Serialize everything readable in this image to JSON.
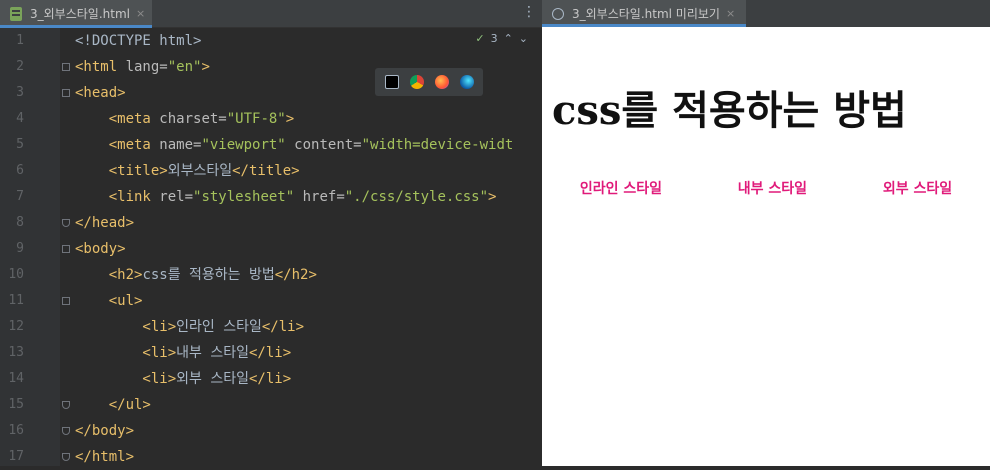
{
  "editor": {
    "tab": {
      "label": "3_외부스타일.html",
      "close": "×"
    },
    "menu_glyph": "⋮",
    "inspection": {
      "count": "3",
      "check": "✓"
    },
    "browser_icons": [
      "pycharm-icon",
      "chrome-icon",
      "firefox-icon",
      "edge-icon"
    ],
    "lines": [
      {
        "n": "1",
        "parts": [
          {
            "t": "&lt;!DOCTYPE html&gt;",
            "c": "text"
          }
        ]
      },
      {
        "n": "2",
        "parts": [
          {
            "t": "<html ",
            "c": "tag"
          },
          {
            "t": "lang=",
            "c": "attr"
          },
          {
            "t": "\"en\"",
            "c": "val"
          },
          {
            "t": ">",
            "c": "tag"
          }
        ]
      },
      {
        "n": "3",
        "parts": [
          {
            "t": "<head>",
            "c": "tag"
          }
        ]
      },
      {
        "n": "4",
        "parts": [
          {
            "t": "    <meta ",
            "c": "tag"
          },
          {
            "t": "charset=",
            "c": "attr"
          },
          {
            "t": "\"UTF-8\"",
            "c": "val"
          },
          {
            "t": ">",
            "c": "tag"
          }
        ]
      },
      {
        "n": "5",
        "parts": [
          {
            "t": "    <meta ",
            "c": "tag"
          },
          {
            "t": "name=",
            "c": "attr"
          },
          {
            "t": "\"viewport\"",
            "c": "val"
          },
          {
            "t": " content=",
            "c": "attr"
          },
          {
            "t": "\"width=device-widt",
            "c": "val"
          }
        ]
      },
      {
        "n": "6",
        "parts": [
          {
            "t": "    <title>",
            "c": "tag"
          },
          {
            "t": "외부스타일",
            "c": "text"
          },
          {
            "t": "</title>",
            "c": "tag"
          }
        ]
      },
      {
        "n": "7",
        "parts": [
          {
            "t": "    <link ",
            "c": "tag"
          },
          {
            "t": "rel=",
            "c": "attr"
          },
          {
            "t": "\"stylesheet\"",
            "c": "val"
          },
          {
            "t": " href=",
            "c": "attr"
          },
          {
            "t": "\"./css/style.css\"",
            "c": "val"
          },
          {
            "t": ">",
            "c": "tag"
          }
        ]
      },
      {
        "n": "8",
        "parts": [
          {
            "t": "</head>",
            "c": "tag"
          }
        ]
      },
      {
        "n": "9",
        "parts": [
          {
            "t": "<body>",
            "c": "tag"
          }
        ]
      },
      {
        "n": "10",
        "parts": [
          {
            "t": "    <h2>",
            "c": "tag"
          },
          {
            "t": "css를 적용하는 방법",
            "c": "text"
          },
          {
            "t": "</h2>",
            "c": "tag"
          }
        ]
      },
      {
        "n": "11",
        "parts": [
          {
            "t": "    <ul>",
            "c": "tag"
          }
        ]
      },
      {
        "n": "12",
        "parts": [
          {
            "t": "        <li>",
            "c": "tag"
          },
          {
            "t": "인라인 스타일",
            "c": "text"
          },
          {
            "t": "</li>",
            "c": "tag"
          }
        ]
      },
      {
        "n": "13",
        "parts": [
          {
            "t": "        <li>",
            "c": "tag"
          },
          {
            "t": "내부 스타일",
            "c": "text"
          },
          {
            "t": "</li>",
            "c": "tag"
          }
        ]
      },
      {
        "n": "14",
        "parts": [
          {
            "t": "        <li>",
            "c": "tag"
          },
          {
            "t": "외부 스타일",
            "c": "text"
          },
          {
            "t": "</li>",
            "c": "tag"
          }
        ]
      },
      {
        "n": "15",
        "parts": [
          {
            "t": "    </ul>",
            "c": "tag"
          }
        ]
      },
      {
        "n": "16",
        "parts": [
          {
            "t": "</body>",
            "c": "tag"
          }
        ]
      },
      {
        "n": "17",
        "parts": [
          {
            "t": "</html>",
            "c": "tag"
          }
        ]
      }
    ]
  },
  "preview": {
    "tab": {
      "label": "3_외부스타일.html 미리보기",
      "close": "×"
    },
    "heading": "css를 적용하는 방법",
    "items": [
      "인라인 스타일",
      "내부 스타일",
      "외부 스타일"
    ],
    "accent_color": "#e01a7a"
  },
  "colors": {
    "editor_bg": "#2b2b2b",
    "tag": "#e8bf6a",
    "string": "#a5c25c",
    "active_tab_underline": "#4a88c7"
  }
}
